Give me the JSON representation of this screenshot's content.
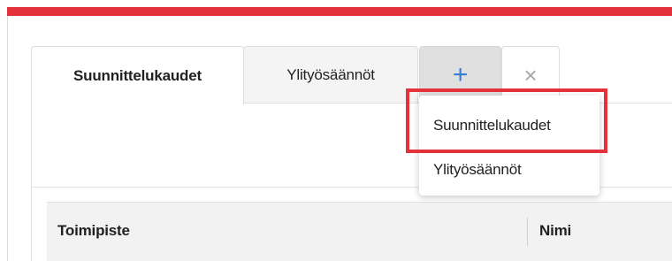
{
  "tabs": [
    {
      "label": "Suunnittelukaudet",
      "active": true
    },
    {
      "label": "Ylityösäännöt",
      "active": false
    }
  ],
  "tab_actions": {
    "add_icon": "+",
    "close_icon": "×"
  },
  "dropdown": {
    "items": [
      {
        "label": "Suunnittelukaudet",
        "highlighted": true
      },
      {
        "label": "Ylityösäännöt",
        "highlighted": false
      }
    ]
  },
  "table": {
    "columns": [
      "Toimipiste",
      "Nimi"
    ]
  },
  "colors": {
    "accent": "#e3323c",
    "add_icon": "#2f80d6",
    "header_bg": "#f2f2f2"
  }
}
